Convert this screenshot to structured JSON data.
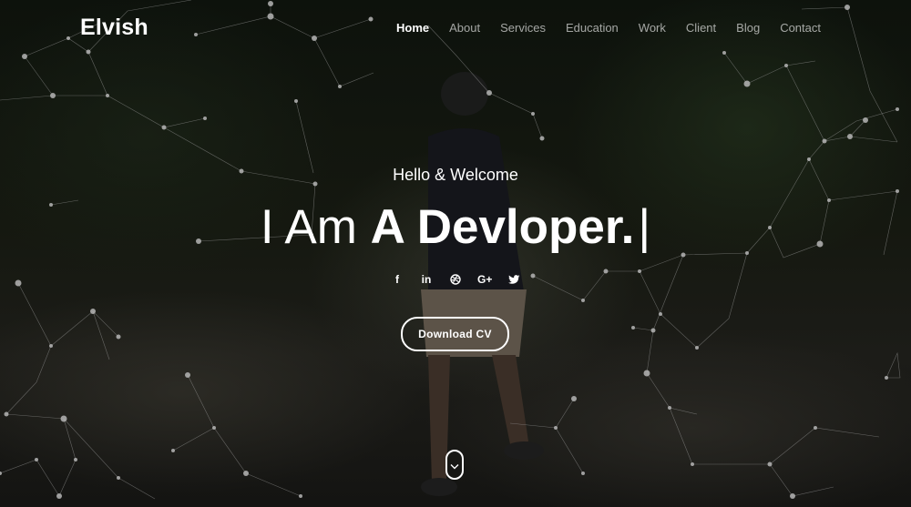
{
  "brand": {
    "name": "Elvish"
  },
  "nav": {
    "items": [
      {
        "label": "Home",
        "active": true
      },
      {
        "label": "About",
        "active": false
      },
      {
        "label": "Services",
        "active": false
      },
      {
        "label": "Education",
        "active": false
      },
      {
        "label": "Work",
        "active": false
      },
      {
        "label": "Client",
        "active": false
      },
      {
        "label": "Blog",
        "active": false
      },
      {
        "label": "Contact",
        "active": false
      }
    ]
  },
  "hero": {
    "greeting": "Hello & Welcome",
    "headline_light": "I Am",
    "headline_bold": "A Devloper.",
    "cursor": "|",
    "cta_label": "Download CV"
  },
  "socials": [
    {
      "name": "facebook-icon",
      "glyph": "f"
    },
    {
      "name": "linkedin-icon",
      "glyph": "in"
    },
    {
      "name": "dribbble-icon",
      "glyph": ""
    },
    {
      "name": "google-plus-icon",
      "glyph": "G+"
    },
    {
      "name": "twitter-icon",
      "glyph": ""
    }
  ],
  "colors": {
    "text": "#ffffff",
    "muted_nav": "#a6a6a6",
    "background": "#0b0d0a",
    "network_lines": "#9a9a9a"
  }
}
